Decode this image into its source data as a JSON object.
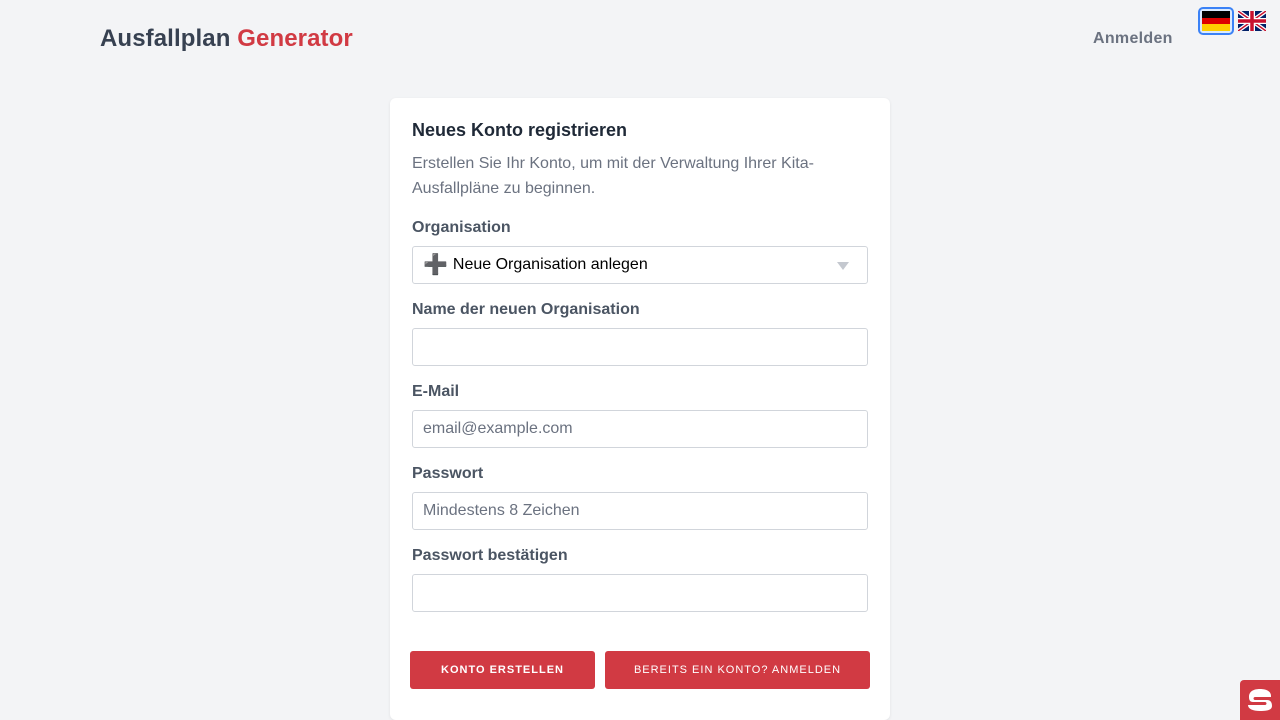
{
  "header": {
    "logo_main": "Ausfallplan",
    "logo_accent": "Generator",
    "login_label": "Anmelden",
    "languages": [
      {
        "code": "de",
        "icon": "flag-de-icon",
        "active": true
      },
      {
        "code": "en",
        "icon": "flag-uk-icon",
        "active": false
      }
    ]
  },
  "form": {
    "title": "Neues Konto registrieren",
    "description": "Erstellen Sie Ihr Konto, um mit der Verwaltung Ihrer Kita-Ausfallpläne zu beginnen.",
    "organisation": {
      "label": "Organisation",
      "selected_icon": "➕",
      "selected_text": "Neue Organisation anlegen"
    },
    "org_name": {
      "label": "Name der neuen Organisation",
      "value": "",
      "placeholder": ""
    },
    "email": {
      "label": "E-Mail",
      "value": "",
      "placeholder": "email@example.com"
    },
    "password": {
      "label": "Passwort",
      "value": "",
      "placeholder": "Mindestens 8 Zeichen"
    },
    "password_confirm": {
      "label": "Passwort bestätigen",
      "value": "",
      "placeholder": ""
    },
    "submit_label": "Konto erstellen",
    "login_button_label": "Bereits ein Konto? Anmelden"
  },
  "colors": {
    "accent": "#d13a43",
    "background": "#f3f4f6",
    "card": "#ffffff"
  },
  "widget": {
    "icon": "chat-logo-icon"
  }
}
